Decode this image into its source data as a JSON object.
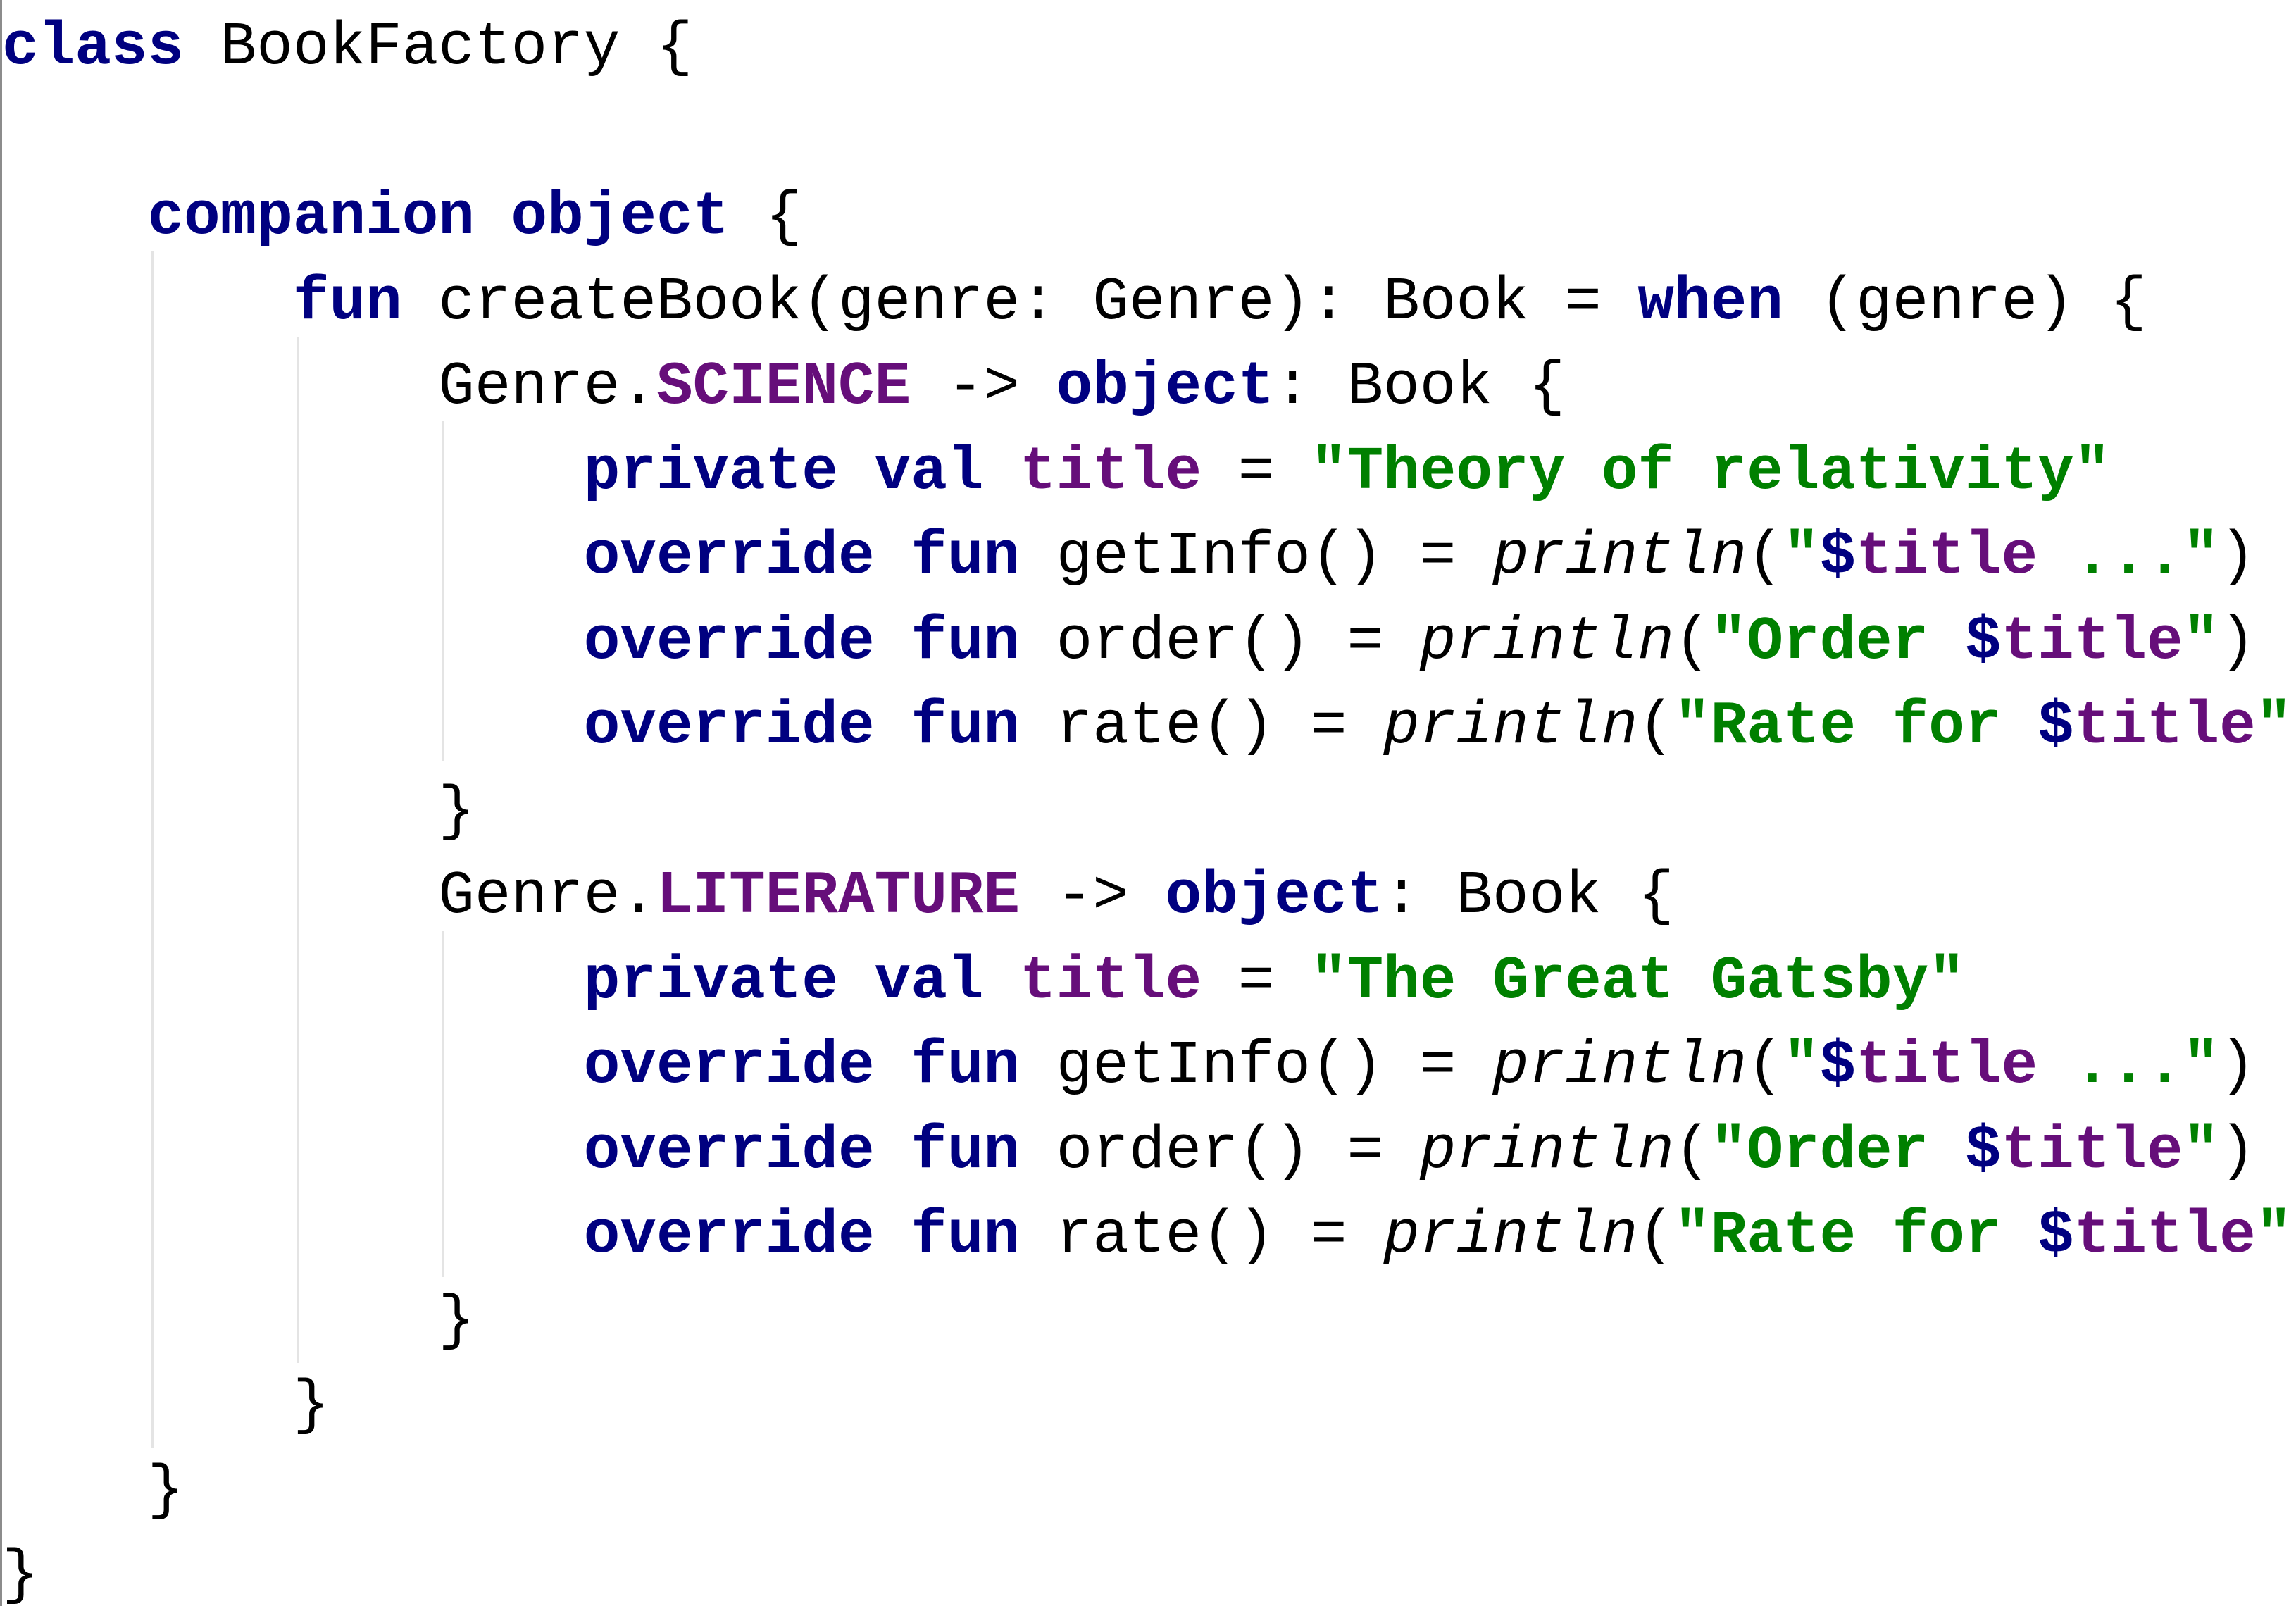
{
  "editor": {
    "language": "Kotlin",
    "colors": {
      "keyword": "#000080",
      "string": "#008000",
      "field": "#660e7a",
      "text": "#000000",
      "indent_guide": "#e4e4e4"
    },
    "lines": [
      [
        {
          "t": "kw",
          "v": "class"
        },
        {
          "t": "pl",
          "v": " BookFactory {"
        }
      ],
      [],
      [
        {
          "t": "pl",
          "v": "    "
        },
        {
          "t": "kw",
          "v": "companion object"
        },
        {
          "t": "pl",
          "v": " {"
        }
      ],
      [
        {
          "t": "pl",
          "v": "        "
        },
        {
          "t": "kw",
          "v": "fun"
        },
        {
          "t": "pl",
          "v": " createBook(genre: Genre): Book = "
        },
        {
          "t": "kw",
          "v": "when"
        },
        {
          "t": "pl",
          "v": " (genre) {"
        }
      ],
      [
        {
          "t": "pl",
          "v": "            Genre."
        },
        {
          "t": "field",
          "v": "SCIENCE"
        },
        {
          "t": "pl",
          "v": " -> "
        },
        {
          "t": "kw",
          "v": "object"
        },
        {
          "t": "pl",
          "v": ": Book {"
        }
      ],
      [
        {
          "t": "pl",
          "v": "                "
        },
        {
          "t": "kw",
          "v": "private val"
        },
        {
          "t": "pl",
          "v": " "
        },
        {
          "t": "field",
          "v": "title"
        },
        {
          "t": "pl",
          "v": " = "
        },
        {
          "t": "str",
          "v": "\"Theory of relativity\""
        }
      ],
      [
        {
          "t": "pl",
          "v": "                "
        },
        {
          "t": "kw",
          "v": "override fun"
        },
        {
          "t": "pl",
          "v": " getInfo() = "
        },
        {
          "t": "it",
          "v": "println"
        },
        {
          "t": "pl",
          "v": "("
        },
        {
          "t": "str",
          "v": "\""
        },
        {
          "t": "kw",
          "v": "$"
        },
        {
          "t": "field",
          "v": "title"
        },
        {
          "t": "str",
          "v": " ...\""
        },
        {
          "t": "pl",
          "v": ")"
        }
      ],
      [
        {
          "t": "pl",
          "v": "                "
        },
        {
          "t": "kw",
          "v": "override fun"
        },
        {
          "t": "pl",
          "v": " order() = "
        },
        {
          "t": "it",
          "v": "println"
        },
        {
          "t": "pl",
          "v": "("
        },
        {
          "t": "str",
          "v": "\"Order "
        },
        {
          "t": "kw",
          "v": "$"
        },
        {
          "t": "field",
          "v": "title"
        },
        {
          "t": "str",
          "v": "\""
        },
        {
          "t": "pl",
          "v": ")"
        }
      ],
      [
        {
          "t": "pl",
          "v": "                "
        },
        {
          "t": "kw",
          "v": "override fun"
        },
        {
          "t": "pl",
          "v": " rate() = "
        },
        {
          "t": "it",
          "v": "println"
        },
        {
          "t": "pl",
          "v": "("
        },
        {
          "t": "str",
          "v": "\"Rate for "
        },
        {
          "t": "kw",
          "v": "$"
        },
        {
          "t": "field",
          "v": "title"
        },
        {
          "t": "str",
          "v": "\""
        },
        {
          "t": "pl",
          "v": ")"
        }
      ],
      [
        {
          "t": "pl",
          "v": "            }"
        }
      ],
      [
        {
          "t": "pl",
          "v": "            Genre."
        },
        {
          "t": "field",
          "v": "LITERATURE"
        },
        {
          "t": "pl",
          "v": " -> "
        },
        {
          "t": "kw",
          "v": "object"
        },
        {
          "t": "pl",
          "v": ": Book {"
        }
      ],
      [
        {
          "t": "pl",
          "v": "                "
        },
        {
          "t": "kw",
          "v": "private val"
        },
        {
          "t": "pl",
          "v": " "
        },
        {
          "t": "field",
          "v": "title"
        },
        {
          "t": "pl",
          "v": " = "
        },
        {
          "t": "str",
          "v": "\"The Great Gatsby\""
        }
      ],
      [
        {
          "t": "pl",
          "v": "                "
        },
        {
          "t": "kw",
          "v": "override fun"
        },
        {
          "t": "pl",
          "v": " getInfo() = "
        },
        {
          "t": "it",
          "v": "println"
        },
        {
          "t": "pl",
          "v": "("
        },
        {
          "t": "str",
          "v": "\""
        },
        {
          "t": "kw",
          "v": "$"
        },
        {
          "t": "field",
          "v": "title"
        },
        {
          "t": "str",
          "v": " ...\""
        },
        {
          "t": "pl",
          "v": ")"
        }
      ],
      [
        {
          "t": "pl",
          "v": "                "
        },
        {
          "t": "kw",
          "v": "override fun"
        },
        {
          "t": "pl",
          "v": " order() = "
        },
        {
          "t": "it",
          "v": "println"
        },
        {
          "t": "pl",
          "v": "("
        },
        {
          "t": "str",
          "v": "\"Order "
        },
        {
          "t": "kw",
          "v": "$"
        },
        {
          "t": "field",
          "v": "title"
        },
        {
          "t": "str",
          "v": "\""
        },
        {
          "t": "pl",
          "v": ")"
        }
      ],
      [
        {
          "t": "pl",
          "v": "                "
        },
        {
          "t": "kw",
          "v": "override fun"
        },
        {
          "t": "pl",
          "v": " rate() = "
        },
        {
          "t": "it",
          "v": "println"
        },
        {
          "t": "pl",
          "v": "("
        },
        {
          "t": "str",
          "v": "\"Rate for "
        },
        {
          "t": "kw",
          "v": "$"
        },
        {
          "t": "field",
          "v": "title"
        },
        {
          "t": "str",
          "v": "\""
        },
        {
          "t": "pl",
          "v": ")"
        }
      ],
      [
        {
          "t": "pl",
          "v": "            }"
        }
      ],
      [
        {
          "t": "pl",
          "v": "        }"
        }
      ],
      [
        {
          "t": "pl",
          "v": "    }"
        }
      ],
      [
        {
          "t": "pl",
          "v": "}"
        }
      ]
    ]
  }
}
